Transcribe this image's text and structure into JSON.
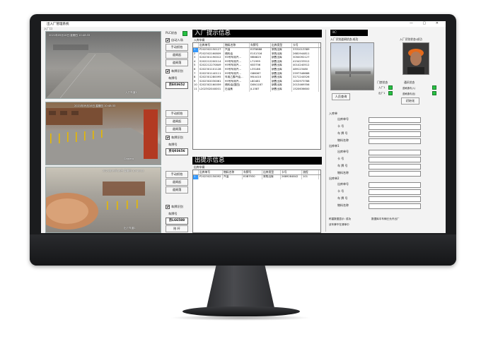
{
  "app": {
    "title": "出入厂管理系统",
    "subtitle": "入厂口",
    "win_controls": "— ▢ ✕"
  },
  "cameras": [
    {
      "overlay": "2021年09月16日 星期四 10:48:33",
      "caption": "入厂车道1",
      "bottom_label": "入厂车道1"
    },
    {
      "overlay": "2021年09月16日 星期四 10:48:33",
      "caption": "入厂车道2",
      "bottom_label": "Camera"
    },
    {
      "overlay": "2021年09月16日 星期四 10:48:33",
      "caption": "出厂车道",
      "bottom_label": "出厂车道1"
    }
  ],
  "lane1": {
    "ptz_label": "PLC状态",
    "auto_label": "自动入场",
    "manual_btn": "手动抓拍",
    "gate_open_btn": "道闸起",
    "gate_close_btn": "道闸落",
    "plate_recog_label": "车牌识别",
    "plate_no_label": "车牌号",
    "plate": "京E03652"
  },
  "lane2": {
    "manual_btn": "手动抓拍",
    "gate_open_btn": "道闸起",
    "gate_close_btn": "道闸落",
    "plate_recog_label": "车牌识别",
    "plate_no_label": "车牌号",
    "plate": "京Q03656"
  },
  "lane3": {
    "manual_btn": "手动抓拍",
    "gate_open_btn": "道闸起",
    "gate_close_btn": "道闸落",
    "plate_recog_label": "车牌识别",
    "plate_no_label": "车牌号",
    "plate": "京L66588",
    "release_btn": "抬 杆"
  },
  "entry_info": {
    "title": "入厂提示信息",
    "subtitle": "入库车辆",
    "columns": [
      "",
      "出库单号",
      "物料名称",
      "车牌号",
      "出库类型",
      "卡号"
    ],
    "rows": [
      [
        "1",
        "P202302150127",
        "汽油",
        "E0T8888",
        "采购出库",
        "3331013389"
      ],
      [
        "2",
        "P202302160809",
        "燃料油",
        "E1S1316",
        "采购出库",
        "2681944811"
      ],
      [
        "3",
        "S202301190012",
        "95号车用汽...",
        "M86825",
        "销售出库",
        "3050092127"
      ],
      [
        "4",
        "S202212200114",
        "95号车用汽...",
        "L71999",
        "销售出库",
        "4154233512"
      ],
      [
        "5",
        "S202212270849",
        "95号车用汽...",
        "K83756",
        "销售出库",
        "4014240512"
      ],
      [
        "6",
        "S202301101128",
        "95号车用汽...",
        "L35186",
        "销售出库",
        "489123480"
      ],
      [
        "7",
        "S202301140111",
        "95号车用汽...",
        "G86067",
        "销售出库",
        "2597346688"
      ],
      [
        "8",
        "S202301280095",
        "车用乙醇汽油...",
        "M44410",
        "销售出库",
        "3271244526"
      ],
      [
        "9",
        "S202302030061",
        "95号车用汽...",
        "L80481",
        "销售出库",
        "1052973788"
      ],
      [
        "10",
        "S202302160059",
        "燃料油(国四)",
        "D0N1187",
        "销售出库",
        "2013469356"
      ],
      [
        "11",
        "L202302040001",
        "石油焦",
        "JL1587",
        "销售出库",
        "1520636600"
      ]
    ]
  },
  "exit_info": {
    "title": "出提示信息",
    "subtitle": "出库车辆",
    "columns": [
      "",
      "出库单号",
      "物料名称",
      "车牌号",
      "出库类型",
      "卡号",
      "流程"
    ],
    "rows": [
      [
        "1",
        "P202302150092",
        "汽油",
        "E0B7930",
        "采购出库",
        "2689284842",
        "101"
      ]
    ]
  },
  "ic_panel": {
    "tab": "IC",
    "cam_status_label": "入厂识别道闸状态:成功",
    "face_status_label": "入厂识别状态:成功",
    "face_btn": "人员查询",
    "ctrl_label": "门禁状态",
    "entry_gate": "入厂1",
    "exit_gate": "出厂1",
    "comm_label": "通讯状态",
    "comm_item1": "道闸通讯(入)",
    "comm_item2": "道闸通讯(出)",
    "reset_btn": "初始化"
  },
  "form": {
    "grp_a": "入库单",
    "fields_a": [
      "出库单号",
      "卡  号",
      "车 牌 号",
      "物料名称"
    ],
    "grp_b": "出库单1",
    "fields_b": [
      "出库单号",
      "卡  号",
      "车 牌 号",
      "物料名称"
    ],
    "grp_c": "出库单2",
    "fields_c": [
      "出库单号",
      "卡  号",
      "车 牌 号",
      "物料名称"
    ],
    "footer1": "称重数据显示: 成功",
    "footer2": "数据库中车辆已允许出厂",
    "footer3": "该车牌不在清单中"
  },
  "colors": {
    "bezel": "#1b1c1e",
    "selection": "#3399ff",
    "led_green": "#27c244",
    "title_bar": "#000000"
  }
}
